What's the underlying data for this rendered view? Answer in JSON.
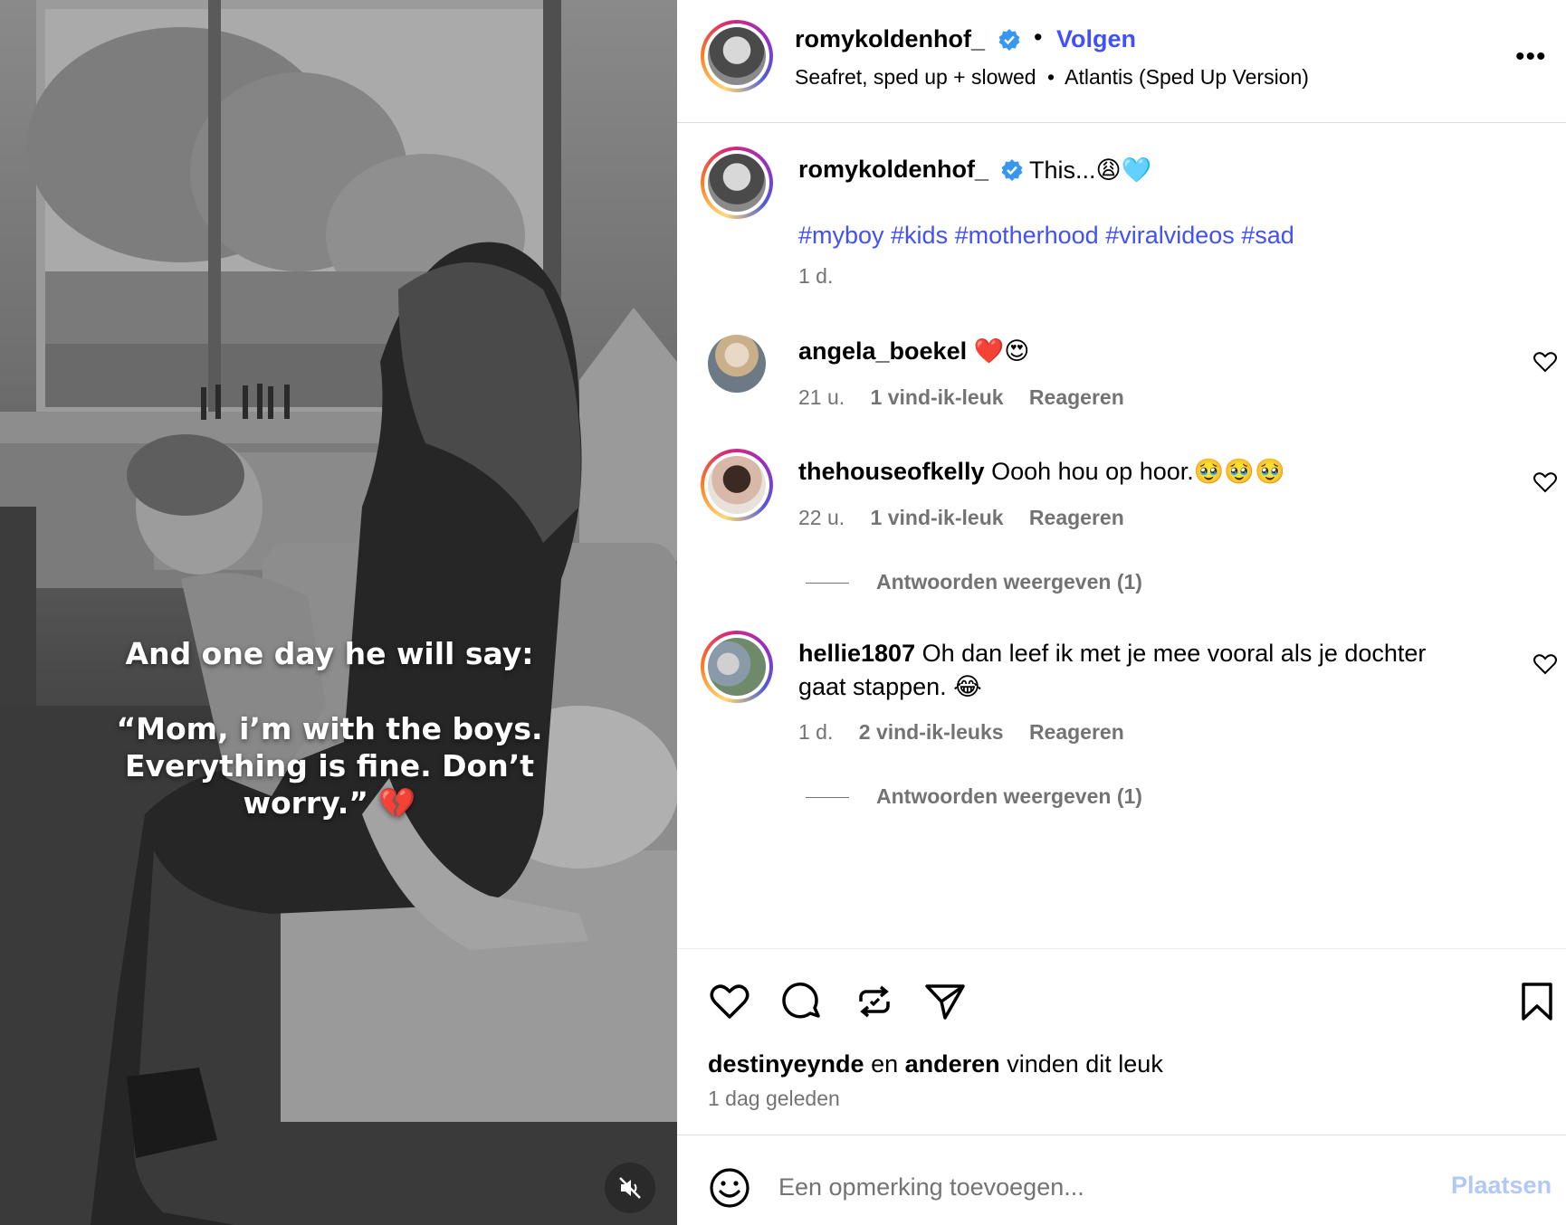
{
  "video": {
    "overlay_line_1": "And one day he will say:",
    "overlay_line_2": "“Mom, i’m with the boys.",
    "overlay_line_3": "Everything is fine. Don’t",
    "overlay_line_4": "worry.” 💔",
    "mute_icon": "speaker-muted-icon"
  },
  "header": {
    "username": "romykoldenhof_",
    "verified": true,
    "dot": "•",
    "follow_label": "Volgen",
    "audio_artist": "Seafret, sped up + slowed",
    "audio_sep": "•",
    "audio_track": "Atlantis (Sped Up Version)",
    "more_label": "•••"
  },
  "caption": {
    "username": "romykoldenhof_",
    "text": "This...😩🩵",
    "hashtags": "#myboy #kids #motherhood #viralvideos #sad",
    "time": "1 d."
  },
  "comments": [
    {
      "username": "angela_boekel",
      "text": "❤️😍",
      "time": "21 u.",
      "likes": "1 vind-ik-leuk",
      "reply": "Reageren"
    },
    {
      "username": "thehouseofkelly",
      "text": "Oooh hou op hoor.🥹🥹🥹",
      "time": "22 u.",
      "likes": "1 vind-ik-leuk",
      "reply": "Reageren",
      "view_replies": "Antwoorden weergeven (1)"
    },
    {
      "username": "hellie1807",
      "text": "Oh dan leef ik met je mee vooral als je dochter",
      "text_2": "gaat stappen. 😂",
      "time": "1 d.",
      "likes": "2 vind-ik-leuks",
      "reply": "Reageren",
      "view_replies": "Antwoorden weergeven (1)"
    }
  ],
  "actions": {
    "like_icon": "heart-icon",
    "comment_icon": "comment-icon",
    "repost_icon": "repost-icon",
    "share_icon": "share-icon",
    "save_icon": "bookmark-icon",
    "liked_by_user": "destinyeynde",
    "liked_by_mid": "en",
    "liked_by_others": "anderen",
    "liked_by_tail": "vinden dit leuk",
    "date": "1 dag geleden"
  },
  "composer": {
    "emoji_icon": "smiley-icon",
    "placeholder": "Een opmerking toevoegen...",
    "post_label": "Plaatsen"
  },
  "colors": {
    "link_blue": "#4150f7",
    "muted_gray": "#737373",
    "post_disabled": "#b2c8f7",
    "verified_blue": "#3897f0"
  }
}
